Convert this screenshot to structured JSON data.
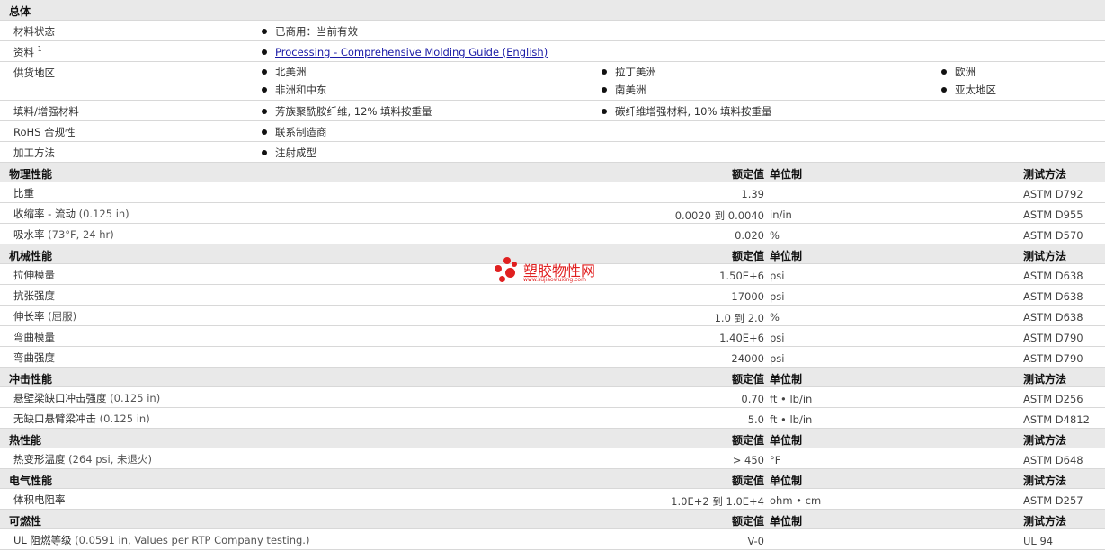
{
  "general": {
    "title": "总体",
    "status_label": "材料状态",
    "status_value": "已商用：当前有效",
    "docs_label": "资料",
    "docs_sup": "1",
    "docs_link": "Processing - Comprehensive Molding Guide (English)",
    "regions_label": "供货地区",
    "regions": [
      "北美洲",
      "拉丁美洲",
      "欧洲",
      "非洲和中东",
      "南美洲",
      "亚太地区"
    ],
    "filler_label": "填料/增强材料",
    "fillers": [
      "芳族聚酰胺纤维, 12% 填料按重量",
      "碳纤维增强材料, 10% 填料按重量"
    ],
    "rohs_label": "RoHS 合规性",
    "rohs_value": "联系制造商",
    "process_label": "加工方法",
    "process_value": "注射成型"
  },
  "headers": {
    "value": "额定值",
    "unit": "单位制",
    "test": "测试方法"
  },
  "physical": {
    "title": "物理性能",
    "rows": [
      {
        "label": "比重",
        "cond": "",
        "value": "1.39",
        "unit": "",
        "test": "ASTM D792"
      },
      {
        "label": "收缩率 - 流动",
        "cond": "(0.125 in)",
        "value": "0.0020 到  0.0040",
        "unit": "in/in",
        "test": "ASTM D955"
      },
      {
        "label": "吸水率",
        "cond": "(73°F, 24 hr)",
        "value": "0.020",
        "unit": "%",
        "test": "ASTM D570"
      }
    ]
  },
  "mechanical": {
    "title": "机械性能",
    "rows": [
      {
        "label": "拉伸模量",
        "cond": "",
        "value": "1.50E+6",
        "unit": "psi",
        "test": "ASTM D638"
      },
      {
        "label": "抗张强度",
        "cond": "",
        "value": "17000",
        "unit": "psi",
        "test": "ASTM D638"
      },
      {
        "label": "伸长率",
        "cond": "(屈服)",
        "value": "1.0 到  2.0",
        "unit": "%",
        "test": "ASTM D638"
      },
      {
        "label": "弯曲模量",
        "cond": "",
        "value": "1.40E+6",
        "unit": "psi",
        "test": "ASTM D790"
      },
      {
        "label": "弯曲强度",
        "cond": "",
        "value": "24000",
        "unit": "psi",
        "test": "ASTM D790"
      }
    ]
  },
  "impact": {
    "title": "冲击性能",
    "rows": [
      {
        "label": "悬壁梁缺口冲击强度",
        "cond": "(0.125 in)",
        "value": "0.70",
        "unit": "ft • lb/in",
        "test": "ASTM D256"
      },
      {
        "label": "无缺口悬臂梁冲击",
        "cond": "(0.125 in)",
        "value": "5.0",
        "unit": "ft • lb/in",
        "test": "ASTM D4812"
      }
    ]
  },
  "thermal": {
    "title": "热性能",
    "rows": [
      {
        "label": "热变形温度",
        "cond": "(264 psi, 未退火)",
        "value": "> 450",
        "unit": "°F",
        "test": "ASTM D648"
      }
    ]
  },
  "electrical": {
    "title": "电气性能",
    "rows": [
      {
        "label": "体积电阻率",
        "cond": "",
        "value": "1.0E+2 到  1.0E+4",
        "unit": "ohm • cm",
        "test": "ASTM D257"
      }
    ]
  },
  "flammability": {
    "title": "可燃性",
    "rows": [
      {
        "label": "UL 阻燃等级",
        "cond": "(0.0591 in, Values per RTP Company testing.)",
        "value": "V-0",
        "unit": "",
        "test": "UL 94"
      }
    ]
  },
  "watermark": {
    "name": "塑胶物性网",
    "url": "www.sujiaowuxing.com",
    "color": "#e02020"
  }
}
